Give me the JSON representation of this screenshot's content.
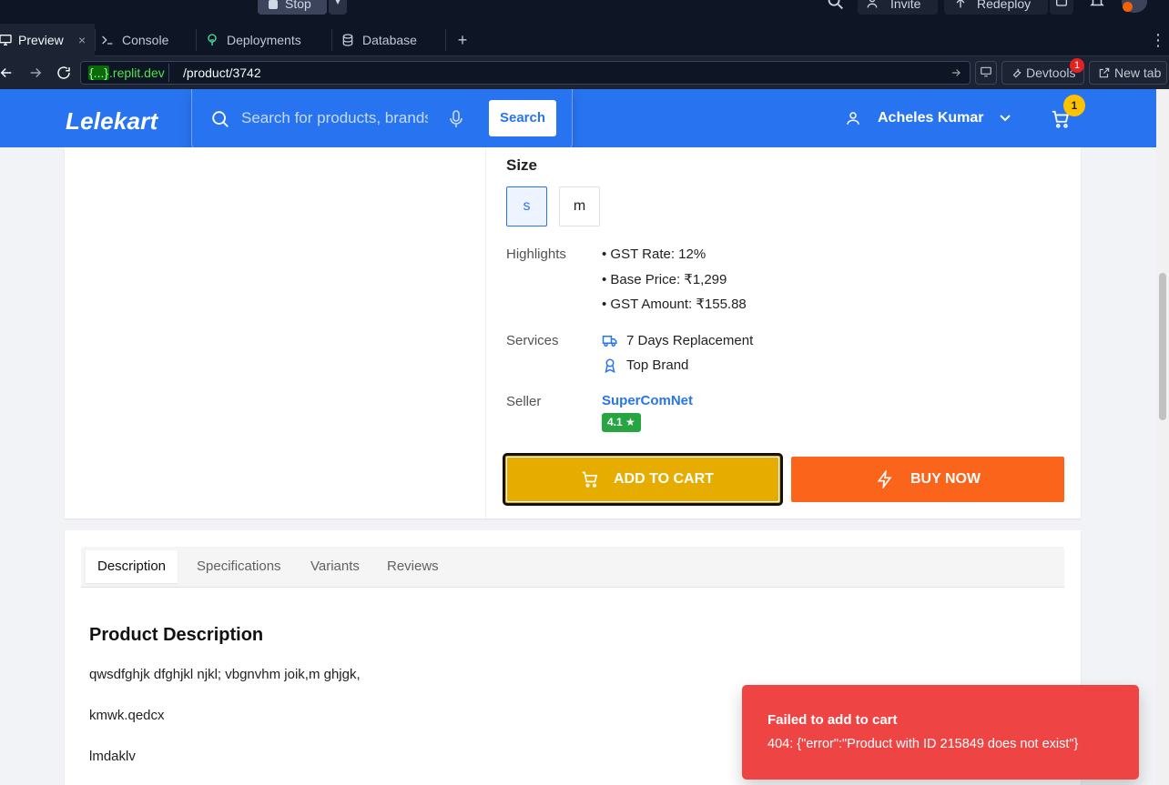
{
  "ide": {
    "stop_label": "Stop",
    "invite_label": "Invite",
    "redeploy_label": "Redeploy",
    "tabs": [
      {
        "label": "Preview",
        "icon": "monitor-icon",
        "active": true
      },
      {
        "label": "Console",
        "icon": "terminal-icon"
      },
      {
        "label": "Deployments",
        "icon": "deploy-icon"
      },
      {
        "label": "Database",
        "icon": "database-icon"
      }
    ],
    "close_glyph": "×",
    "add_tab_glyph": "+",
    "url": {
      "domain_prefix": "{...}",
      "domain_suffix": ".replit.dev",
      "path": "/product/3742"
    },
    "devtools_label": "Devtools",
    "devtools_badge": "1",
    "new_tab_label": "New tab"
  },
  "header": {
    "logo": "Lelekart",
    "search": {
      "placeholder": "Search for products, brands and more",
      "button_label": "Search"
    },
    "user_name": "Acheles Kumar",
    "cart_count": "1",
    "brand_color": "#2874f0"
  },
  "product": {
    "size_title": "Size",
    "sizes": [
      {
        "label": "s",
        "selected": true
      },
      {
        "label": "m",
        "selected": false
      }
    ],
    "highlights_label": "Highlights",
    "highlights": [
      "• GST Rate: 12%",
      "• Base Price: ₹1,299",
      "• GST Amount: ₹155.88"
    ],
    "services_label": "Services",
    "services": [
      {
        "label": "7 Days Replacement",
        "icon": "truck-icon"
      },
      {
        "label": "Top Brand",
        "icon": "award-icon"
      }
    ],
    "seller_label": "Seller",
    "seller_name": "SuperComNet",
    "seller_rating": "4.1 ★",
    "add_to_cart_label": "ADD TO CART",
    "buy_now_label": "BUY NOW",
    "add_to_cart_color": "#e6ac00",
    "buy_now_color": "#fb641b"
  },
  "details": {
    "tabs": [
      "Description",
      "Specifications",
      "Variants",
      "Reviews"
    ],
    "active_tab": "Description",
    "title": "Product Description",
    "lines": [
      "qwsdfghjk dfghjkl njkl; vbgnvhm joik,m ghjgk,",
      "kmwk.qedcx",
      "lmdaklv"
    ]
  },
  "toast": {
    "title": "Failed to add to cart",
    "message": "404: {\"error\":\"Product with ID 215849 does not exist\"}",
    "color": "#ef4444"
  }
}
